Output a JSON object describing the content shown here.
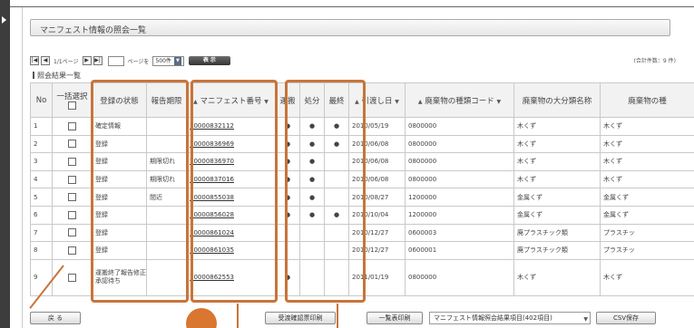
{
  "page": {
    "title": "マニフェスト情報の照会一覧",
    "section_heading": "照会結果一覧",
    "total_count": "(合計件数：9 件)"
  },
  "pager": {
    "first_icon": "first-page-icon",
    "prev_icon": "prev-page-icon",
    "page_status": "1/1ページ",
    "next_icon": "next-page-icon",
    "last_icon": "last-page-icon",
    "page_input_value": "",
    "page_suffix": "ページを",
    "per_page": "500件",
    "show_label": "表 示"
  },
  "table": {
    "headers": {
      "no": "No",
      "bulk_select": "一括選択",
      "reg_status": "登録の状態",
      "report_deadline": "報告期限",
      "manifest_no": "マニフェスト番号",
      "transport": "運搬",
      "disposal": "処分",
      "final": "最終",
      "handover_date": "引渡し日",
      "waste_code": "廃棄物の種類コード",
      "waste_major": "廃棄物の大分類名称",
      "waste_minor": "廃棄物の種"
    },
    "sort_glyphs": {
      "manifest": "▲",
      "manifest_end": "▼",
      "handover": "▲",
      "handover_end": "▼",
      "waste_code": "▲",
      "waste_code_end": "▼"
    },
    "rows": [
      {
        "no": "1",
        "status": "確定情報",
        "deadline": "",
        "manifest": "70000832112",
        "transport": "●",
        "disposal": "●",
        "final": "●",
        "date": "2010/05/19",
        "code": "0800000",
        "major": "木くず",
        "minor": "木くず"
      },
      {
        "no": "2",
        "status": "登録",
        "deadline": "",
        "manifest": "70000836969",
        "transport": "●",
        "disposal": "●",
        "final": "●",
        "date": "2010/06/08",
        "code": "0800000",
        "major": "木くず",
        "minor": "木くず"
      },
      {
        "no": "3",
        "status": "登録",
        "deadline": "期限切れ",
        "manifest": "70000836970",
        "transport": "●",
        "disposal": "●",
        "final": "",
        "date": "2010/06/08",
        "code": "0800000",
        "major": "木くず",
        "minor": "木くず"
      },
      {
        "no": "4",
        "status": "登録",
        "deadline": "期限切れ",
        "manifest": "70000837016",
        "transport": "●",
        "disposal": "●",
        "final": "",
        "date": "2010/06/08",
        "code": "0800000",
        "major": "木くず",
        "minor": "木くず"
      },
      {
        "no": "5",
        "status": "登録",
        "deadline": "間近",
        "manifest": "70000855038",
        "transport": "●",
        "disposal": "●",
        "final": "",
        "date": "2010/08/27",
        "code": "1200000",
        "major": "金属くず",
        "minor": "金属くず"
      },
      {
        "no": "6",
        "status": "登録",
        "deadline": "",
        "manifest": "70000856028",
        "transport": "●",
        "disposal": "●",
        "final": "●",
        "date": "2010/10/04",
        "code": "1200000",
        "major": "金属くず",
        "minor": "金属くず"
      },
      {
        "no": "7",
        "status": "登録",
        "deadline": "",
        "manifest": "70000861024",
        "transport": "",
        "disposal": "",
        "final": "",
        "date": "2010/12/27",
        "code": "0600003",
        "major": "廃プラスチック類",
        "minor": "プラスチッ"
      },
      {
        "no": "8",
        "status": "登録",
        "deadline": "",
        "manifest": "70000861035",
        "transport": "",
        "disposal": "",
        "final": "",
        "date": "2010/12/27",
        "code": "0600001",
        "major": "廃プラスチック類",
        "minor": "プラスチッ"
      },
      {
        "no": "9",
        "status": "運搬終了報告修正承認待ち",
        "deadline": "",
        "manifest": "70000862553",
        "transport": "●",
        "disposal": "",
        "final": "",
        "date": "2011/01/19",
        "code": "0800000",
        "major": "木くず",
        "minor": "木くず"
      }
    ]
  },
  "bottom": {
    "back_label": "戻 る",
    "receipt_print_label": "受渡確認票印刷",
    "list_print_label": "一覧表印刷",
    "items_select": "マニフェスト情報照会結果項目(402項目)",
    "csv_label": "CSV保存"
  },
  "colors": {
    "highlight": "#c8743a",
    "accent_circle": "#d9762f"
  }
}
